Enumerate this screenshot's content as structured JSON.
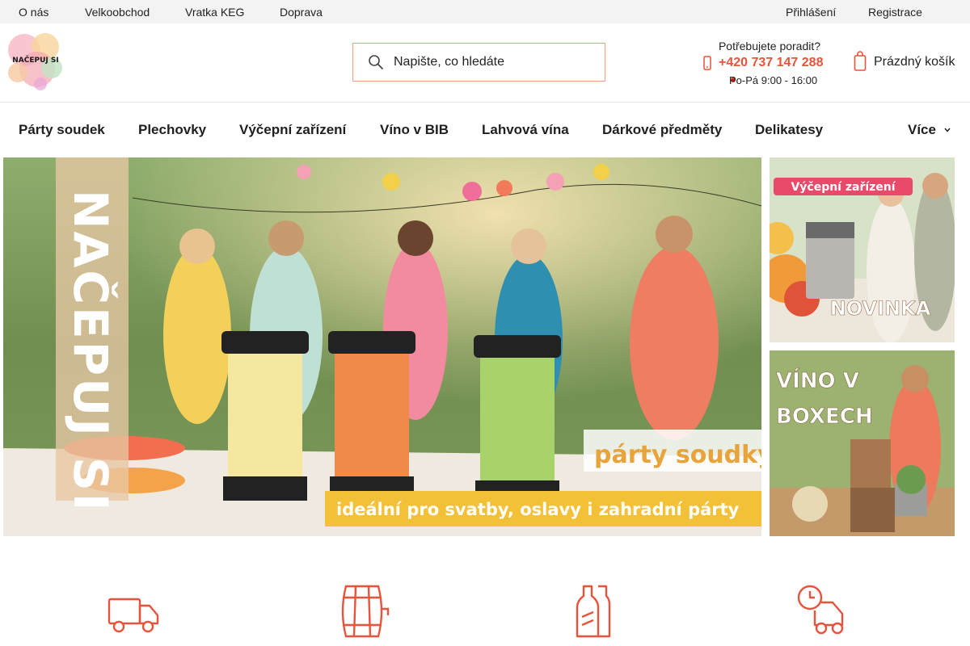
{
  "topbar": {
    "links": [
      "O nás",
      "Velkoobchod",
      "Vratka KEG",
      "Doprava"
    ],
    "login": "Přihlášení",
    "register": "Registrace"
  },
  "logo": {
    "text": "NAČEPUJ SI"
  },
  "search": {
    "placeholder": "Napište, co hledáte",
    "icon": "search-icon"
  },
  "contact": {
    "question": "Potřebujete poradit?",
    "phone": "+420 737 147 288",
    "hours": "Po-Pá 9:00 - 16:00"
  },
  "cart": {
    "label": "Prázdný košík",
    "icon": "cart-icon"
  },
  "nav": {
    "items": [
      "Párty soudek",
      "Plechovky",
      "Výčepní zařízení",
      "Víno v BIB",
      "Lahvová vína",
      "Dárkové předměty",
      "Delikatesy"
    ],
    "more": "Více"
  },
  "hero": {
    "vertical_title": "NAČEPUJ SI",
    "tagline": "párty soudky",
    "subtitle": "ideální pro svatby, oslavy i zahradní párty"
  },
  "side_banners": [
    {
      "title": "Výčepní zařízení",
      "badge": "NOVINKA"
    },
    {
      "title_line1": "VÍNO V",
      "title_line2": "BOXECH"
    }
  ],
  "features": [
    "truck-icon",
    "barrel-icon",
    "bottles-icon",
    "timed-delivery-icon"
  ],
  "colors": {
    "accent": "#e8543b",
    "topbar_bg": "#f3f3f3"
  }
}
